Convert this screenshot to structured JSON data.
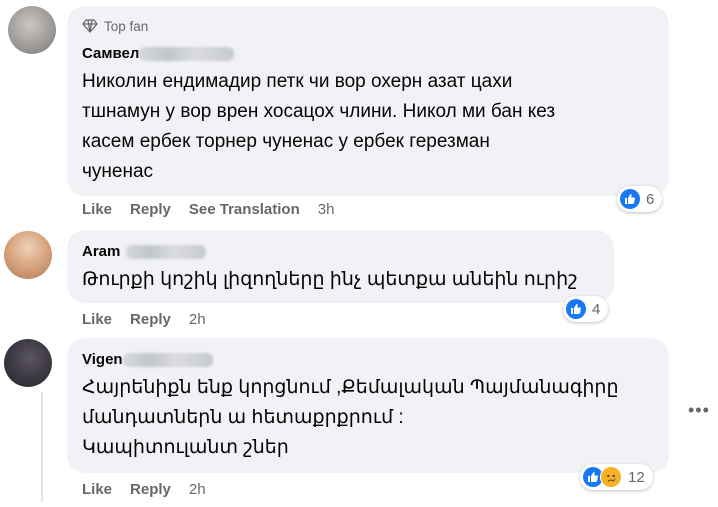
{
  "comments": [
    {
      "badge": "Top fan",
      "name": "Самвел",
      "text": "Николин ендимадир петк чи вор охерн азат цахи\nтшнамун у вор врен хосацох члини. Никол ми бан кез\nкасем ербек торнер чуненас у ербек герезман\nчуненас",
      "actions": {
        "like": "Like",
        "reply": "Reply",
        "translate": "See Translation",
        "time": "3h"
      },
      "reaction_count": "6"
    },
    {
      "name": "Aram",
      "text": "Թուրքի կոշիկ լիզողները ինչ պետքա անեին ուրիշ",
      "actions": {
        "like": "Like",
        "reply": "Reply",
        "time": "2h"
      },
      "reaction_count": "4"
    },
    {
      "name": "Vigen",
      "text": "Հայրենիքն ենք կորցնում ,Քեմալական Պայմանագիրը\nմանդատներն ա հետաքրքրում :\nԿապիտուլանտ շներ",
      "actions": {
        "like": "Like",
        "reply": "Reply",
        "time": "2h"
      },
      "reaction_count": "12"
    }
  ],
  "colors": {
    "bubble": "#f0f2f5",
    "meta": "#65676b",
    "like_blue": "#1877f2",
    "sad_yellow": "#f7b125"
  },
  "icons": [
    "diamond-icon",
    "like-icon",
    "sad-icon",
    "more-icon"
  ]
}
